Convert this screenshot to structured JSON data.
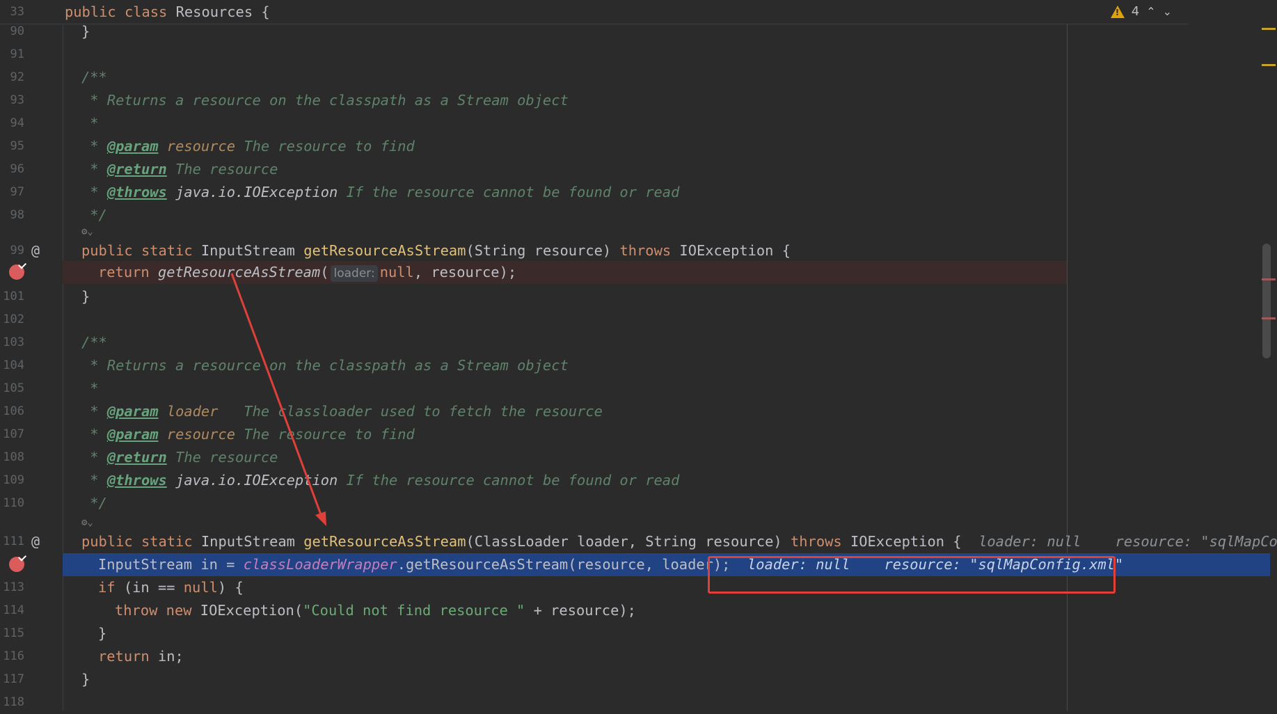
{
  "sticky_header": {
    "line_number": "33",
    "code": "public class Resources {",
    "kw1": "public",
    "kw2": "class",
    "name": "Resources {"
  },
  "warnings": {
    "count": "4"
  },
  "lines": [
    {
      "n": "90",
      "text": "}"
    },
    {
      "n": "91",
      "text": ""
    },
    {
      "n": "92",
      "text": "/**"
    },
    {
      "n": "93",
      "text": " * Returns a resource on the classpath as a Stream object"
    },
    {
      "n": "94",
      "text": " *"
    },
    {
      "n": "95",
      "tag": "@param",
      "param": "resource",
      "desc": " The resource to find"
    },
    {
      "n": "96",
      "tag": "@return",
      "desc": " The resource"
    },
    {
      "n": "97",
      "tag": "@throws",
      "ref": "java.io.IOException",
      "desc": " If the resource cannot be found or read"
    },
    {
      "n": "98",
      "text": " */"
    },
    {
      "n": "99"
    },
    {
      "n": "100"
    },
    {
      "n": "101",
      "text": "}"
    },
    {
      "n": "102",
      "text": ""
    },
    {
      "n": "103",
      "text": "/**"
    },
    {
      "n": "104",
      "text": " * Returns a resource on the classpath as a Stream object"
    },
    {
      "n": "105",
      "text": " *"
    },
    {
      "n": "106",
      "tag": "@param",
      "param": "loader",
      "desc": "   The classloader used to fetch the resource"
    },
    {
      "n": "107",
      "tag": "@param",
      "param": "resource",
      "desc": " The resource to find"
    },
    {
      "n": "108",
      "tag": "@return",
      "desc": " The resource"
    },
    {
      "n": "109",
      "tag": "@throws",
      "ref": "java.io.IOException",
      "desc": " If the resource cannot be found or read"
    },
    {
      "n": "110",
      "text": " */"
    },
    {
      "n": "111"
    },
    {
      "n": "112"
    },
    {
      "n": "113"
    },
    {
      "n": "114"
    },
    {
      "n": "115",
      "text": "}"
    },
    {
      "n": "116"
    },
    {
      "n": "117",
      "text": "}"
    },
    {
      "n": "118",
      "text": ""
    }
  ],
  "line99": {
    "kw1": "public",
    "kw2": "static",
    "type": "InputStream",
    "method": "getResourceAsStream",
    "params": "(String resource)",
    "throws": "throws",
    "exc": "IOException {"
  },
  "line100": {
    "kw": "return",
    "call": "getResourceAsStream",
    "open": "(",
    "hint": "loader:",
    "null": "null",
    "rest": ", resource);"
  },
  "line111": {
    "kw1": "public",
    "kw2": "static",
    "type": "InputStream",
    "method": "getResourceAsStream",
    "params": "(ClassLoader loader, String resource)",
    "throws": "throws",
    "exc": "IOException {",
    "dbg1": "loader: null",
    "dbg2": "resource: \"sqlMapConf"
  },
  "line112": {
    "decl": "InputStream in = ",
    "field": "classLoaderWrapper",
    "call": ".getResourceAsStream(resource, loader);",
    "dbg1": "loader: null",
    "dbg2": "resource: \"sqlMapConfig.xml\""
  },
  "line113": {
    "kw": "if",
    "rest": " (in == ",
    "null": "null",
    "end": ") {"
  },
  "line114": {
    "kw1": "throw",
    "kw2": "new",
    "cls": "IOException(",
    "str": "\"Could not find resource \"",
    "rest": " + resource);"
  },
  "line116": {
    "kw": "return",
    "rest": " in;"
  },
  "colors": {
    "breakpoint": "#db5c5c",
    "current_line": "#214283",
    "annotation_box": "#e0403a",
    "arrow": "#e0403a"
  }
}
